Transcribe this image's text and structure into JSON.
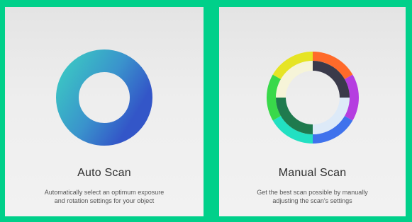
{
  "colors": {
    "background": "#00d08a",
    "card_background": "#eeeeee",
    "auto_ring_start": "#3bc4c4",
    "auto_ring_end": "#3356c8",
    "title_text": "#2e2e2e",
    "description_text": "#555555"
  },
  "cards": [
    {
      "title": "Auto Scan",
      "description_line1": "Automatically select an optimum exposure",
      "description_line2": "and rotation settings for your object",
      "icon": "auto-scan-ring-icon"
    },
    {
      "title": "Manual Scan",
      "description_line1": "Get the best scan possible by manually",
      "description_line2": "adjusting the scan's settings",
      "icon": "manual-scan-color-wheel-icon"
    }
  ]
}
